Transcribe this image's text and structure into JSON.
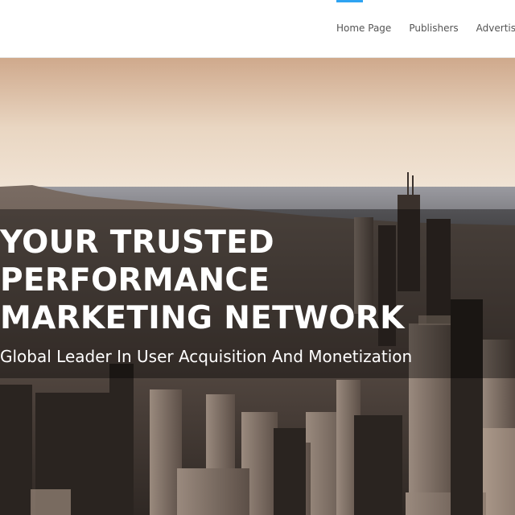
{
  "nav": {
    "items": [
      {
        "label": "Home Page"
      },
      {
        "label": "Publishers"
      },
      {
        "label": "Advertisers"
      }
    ]
  },
  "hero": {
    "title_lines": [
      "YOUR TRUSTED",
      "PERFORMANCE",
      "MARKETING NETWORK"
    ],
    "subtitle": "Global Leader In User Acquisition And Monetization",
    "image": "city-skyline-aerial"
  },
  "colors": {
    "accent": "#2ea3f2",
    "nav_text": "#555555",
    "hero_text": "#ffffff"
  }
}
